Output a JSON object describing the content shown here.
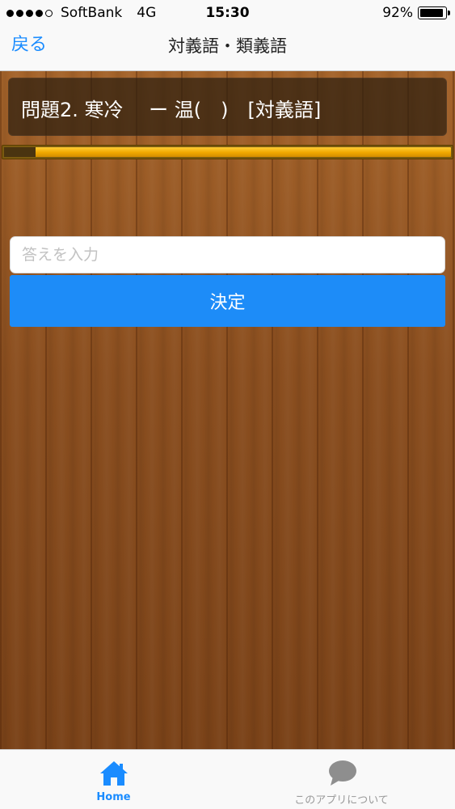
{
  "status_bar": {
    "carrier": "SoftBank",
    "network": "4G",
    "time": "15:30",
    "battery": "92%",
    "battery_level": 0.92,
    "signal_bars_filled": 4,
    "signal_bars_total": 5
  },
  "nav": {
    "back_label": "戻る",
    "title": "対義語・類義語"
  },
  "question": {
    "text": "問題2. 寒冷　 ー 温(　)　[対義語]"
  },
  "progress": {
    "fraction": 0.07
  },
  "answer": {
    "placeholder": "答えを入力",
    "value": ""
  },
  "submit": {
    "label": "決定"
  },
  "tabs": {
    "home": {
      "label": "Home",
      "icon": "home-icon",
      "active": true
    },
    "about": {
      "label": "このアプリについて",
      "icon": "speech-bubble-icon",
      "active": false
    }
  },
  "colors": {
    "accent": "#1a8cff",
    "button": "#1d8cf8",
    "progress_fill": "#f0a800",
    "wood": "#8a4e1f"
  }
}
